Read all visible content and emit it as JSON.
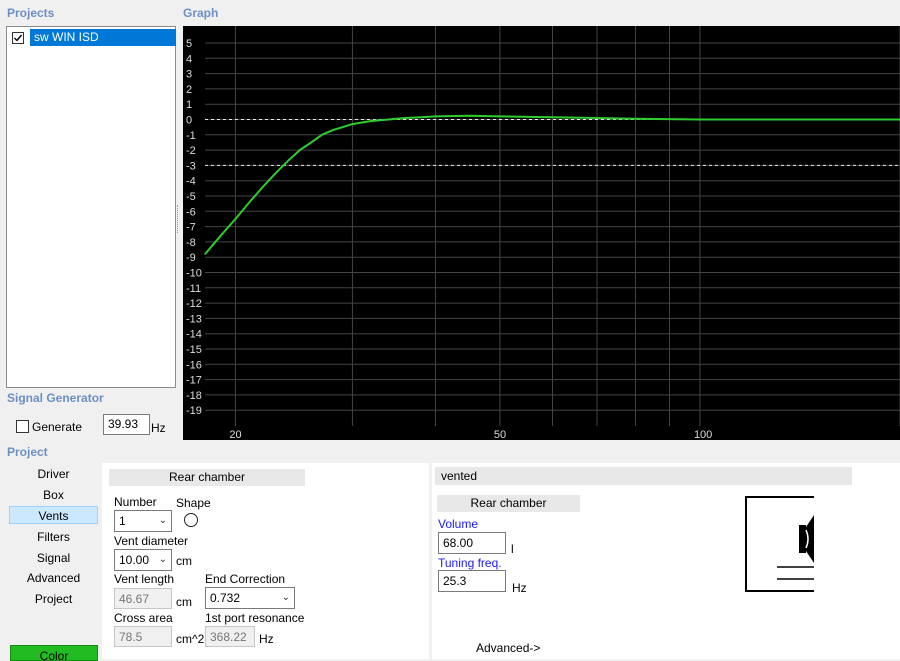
{
  "projects": {
    "title": "Projects",
    "items": [
      {
        "name": "sw WIN ISD",
        "checked": true
      }
    ]
  },
  "graph": {
    "title": "Graph",
    "y_ticks": [
      "5",
      "4",
      "3",
      "2",
      "1",
      "0",
      "-1",
      "-2",
      "-3",
      "-4",
      "-5",
      "-6",
      "-7",
      "-8",
      "-9",
      "-10",
      "-11",
      "-12",
      "-13",
      "-14",
      "-15",
      "-16",
      "-17",
      "-18",
      "-19"
    ],
    "x_ticks": [
      "20",
      "50",
      "100"
    ]
  },
  "chart_data": {
    "type": "line",
    "xscale": "log",
    "xlim": [
      18,
      200
    ],
    "ylim": [
      -20,
      6
    ],
    "x_ticks": [
      20,
      50,
      100
    ],
    "y_ticks": [
      5,
      4,
      3,
      2,
      1,
      0,
      -1,
      -2,
      -3,
      -4,
      -5,
      -6,
      -7,
      -8,
      -9,
      -10,
      -11,
      -12,
      -13,
      -14,
      -15,
      -16,
      -17,
      -18,
      -19
    ],
    "reference_lines": [
      0,
      -3
    ],
    "series": [
      {
        "color": "#2ecc2e",
        "x": [
          18,
          19,
          20,
          21,
          22,
          23,
          24,
          25,
          26,
          27,
          28,
          30,
          32,
          34,
          36,
          38,
          40,
          45,
          50,
          60,
          70,
          80,
          100,
          150,
          200
        ],
        "y": [
          -8.8,
          -7.6,
          -6.5,
          -5.4,
          -4.4,
          -3.5,
          -2.7,
          -2.0,
          -1.5,
          -1.0,
          -0.7,
          -0.3,
          -0.1,
          0.0,
          0.1,
          0.15,
          0.2,
          0.25,
          0.2,
          0.15,
          0.1,
          0.05,
          0.0,
          0.0,
          0.0
        ]
      }
    ]
  },
  "signal_generator": {
    "title": "Signal Generator",
    "generate_label": "Generate",
    "generate_checked": false,
    "freq_value": "39.93",
    "freq_unit": "Hz"
  },
  "project_section": {
    "title": "Project",
    "nav": [
      "Driver",
      "Box",
      "Vents",
      "Filters",
      "Signal",
      "Advanced",
      "Project"
    ],
    "active_nav": "Vents",
    "color_button": "Color"
  },
  "vents_panel": {
    "header": "Rear chamber",
    "number_label": "Number",
    "number_value": "1",
    "shape_label": "Shape",
    "vent_diameter_label": "Vent diameter",
    "vent_diameter_value": "10.00",
    "vent_diameter_unit": "cm",
    "vent_length_label": "Vent length",
    "vent_length_value": "46.67",
    "vent_length_unit": "cm",
    "end_correction_label": "End Correction",
    "end_correction_value": "0.732",
    "cross_area_label": "Cross area",
    "cross_area_value": "78.5",
    "cross_area_unit": "cm^2",
    "port_resonance_label": "1st port resonance",
    "port_resonance_value": "368.22",
    "port_resonance_unit": "Hz"
  },
  "box_panel": {
    "type_label": "vented",
    "header": "Rear chamber",
    "volume_label": "Volume",
    "volume_value": "68.00",
    "volume_unit": "l",
    "tuning_label": "Tuning freq.",
    "tuning_value": "25.3",
    "tuning_unit": "Hz",
    "advanced_link": "Advanced->"
  }
}
